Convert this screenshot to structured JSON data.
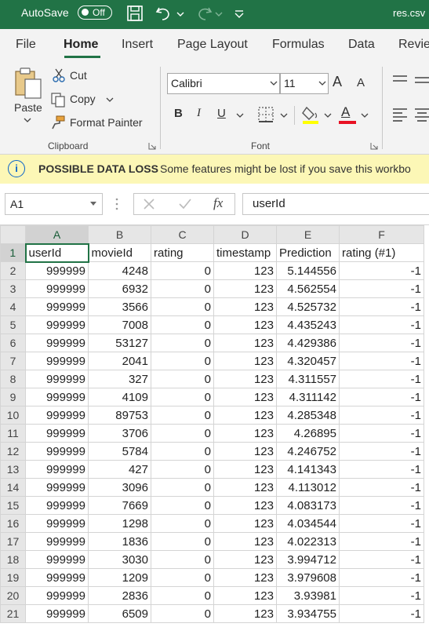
{
  "titlebar": {
    "autosave_label": "AutoSave",
    "autosave_state": "Off",
    "filename": "res.csv"
  },
  "tabs": [
    "File",
    "Home",
    "Insert",
    "Page Layout",
    "Formulas",
    "Data",
    "Revie"
  ],
  "active_tab": "Home",
  "clipboard": {
    "paste": "Paste",
    "cut": "Cut",
    "copy": "Copy",
    "format_painter": "Format Painter",
    "group_label": "Clipboard"
  },
  "font": {
    "family": "Calibri",
    "size": "11",
    "grow": "A",
    "shrink": "A",
    "bold": "B",
    "italic": "I",
    "underline": "U",
    "font_color": "A",
    "group_label": "Font",
    "highlight_color": "#ffff00",
    "text_color": "#e81123"
  },
  "message_bar": {
    "icon": "info-icon",
    "title": "POSSIBLE DATA LOSS",
    "body": "Some features might be lost if you save this workbo"
  },
  "formula_bar": {
    "name_box": "A1",
    "fx": "fx",
    "value": "userId"
  },
  "sheet": {
    "columns": [
      "A",
      "B",
      "C",
      "D",
      "E",
      "F"
    ],
    "headers": [
      "userId",
      "movieId",
      "rating",
      "timestamp",
      "Prediction",
      "rating (#1)"
    ],
    "rows": [
      [
        "999999",
        "4248",
        "0",
        "123",
        "5.144556",
        "-1"
      ],
      [
        "999999",
        "6932",
        "0",
        "123",
        "4.562554",
        "-1"
      ],
      [
        "999999",
        "3566",
        "0",
        "123",
        "4.525732",
        "-1"
      ],
      [
        "999999",
        "7008",
        "0",
        "123",
        "4.435243",
        "-1"
      ],
      [
        "999999",
        "53127",
        "0",
        "123",
        "4.429386",
        "-1"
      ],
      [
        "999999",
        "2041",
        "0",
        "123",
        "4.320457",
        "-1"
      ],
      [
        "999999",
        "327",
        "0",
        "123",
        "4.311557",
        "-1"
      ],
      [
        "999999",
        "4109",
        "0",
        "123",
        "4.311142",
        "-1"
      ],
      [
        "999999",
        "89753",
        "0",
        "123",
        "4.285348",
        "-1"
      ],
      [
        "999999",
        "3706",
        "0",
        "123",
        "4.26895",
        "-1"
      ],
      [
        "999999",
        "5784",
        "0",
        "123",
        "4.246752",
        "-1"
      ],
      [
        "999999",
        "427",
        "0",
        "123",
        "4.141343",
        "-1"
      ],
      [
        "999999",
        "3096",
        "0",
        "123",
        "4.113012",
        "-1"
      ],
      [
        "999999",
        "7669",
        "0",
        "123",
        "4.083173",
        "-1"
      ],
      [
        "999999",
        "1298",
        "0",
        "123",
        "4.034544",
        "-1"
      ],
      [
        "999999",
        "1836",
        "0",
        "123",
        "4.022313",
        "-1"
      ],
      [
        "999999",
        "3030",
        "0",
        "123",
        "3.994712",
        "-1"
      ],
      [
        "999999",
        "1209",
        "0",
        "123",
        "3.979608",
        "-1"
      ],
      [
        "999999",
        "2836",
        "0",
        "123",
        "3.93981",
        "-1"
      ],
      [
        "999999",
        "6509",
        "0",
        "123",
        "3.934755",
        "-1"
      ]
    ]
  },
  "theme": {
    "accent": "#217346",
    "message_bar_bg": "#fcf7b6"
  }
}
